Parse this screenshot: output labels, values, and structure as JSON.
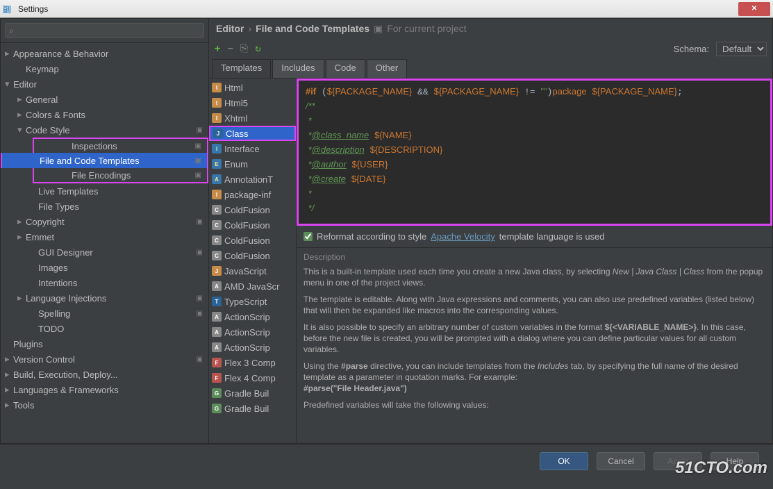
{
  "window_title": "Settings",
  "search_placeholder": "",
  "tree": [
    {
      "label": "Appearance & Behavior",
      "lvl": 0,
      "arrow": "closed"
    },
    {
      "label": "Keymap",
      "lvl": 1,
      "arrow": ""
    },
    {
      "label": "Editor",
      "lvl": 0,
      "arrow": "open"
    },
    {
      "label": "General",
      "lvl": 1,
      "arrow": "closed"
    },
    {
      "label": "Colors & Fonts",
      "lvl": 1,
      "arrow": "closed"
    },
    {
      "label": "Code Style",
      "lvl": 1,
      "arrow": "open",
      "proj": true
    },
    {
      "label": "Inspections",
      "lvl": 2,
      "arrow": "",
      "proj": true,
      "hl_top": true
    },
    {
      "label": "File and Code Templates",
      "lvl": 2,
      "arrow": "",
      "proj": true,
      "selected": true,
      "hl_mid": true
    },
    {
      "label": "File Encodings",
      "lvl": 2,
      "arrow": "",
      "proj": true,
      "hl_bot": true
    },
    {
      "label": "Live Templates",
      "lvl": 2,
      "arrow": ""
    },
    {
      "label": "File Types",
      "lvl": 2,
      "arrow": ""
    },
    {
      "label": "Copyright",
      "lvl": 1,
      "arrow": "closed",
      "proj": true
    },
    {
      "label": "Emmet",
      "lvl": 1,
      "arrow": "closed"
    },
    {
      "label": "GUI Designer",
      "lvl": 2,
      "arrow": "",
      "proj": true
    },
    {
      "label": "Images",
      "lvl": 2,
      "arrow": ""
    },
    {
      "label": "Intentions",
      "lvl": 2,
      "arrow": ""
    },
    {
      "label": "Language Injections",
      "lvl": 1,
      "arrow": "closed",
      "proj": true
    },
    {
      "label": "Spelling",
      "lvl": 2,
      "arrow": "",
      "proj": true
    },
    {
      "label": "TODO",
      "lvl": 2,
      "arrow": ""
    },
    {
      "label": "Plugins",
      "lvl": 0,
      "arrow": ""
    },
    {
      "label": "Version Control",
      "lvl": 0,
      "arrow": "closed",
      "proj": true
    },
    {
      "label": "Build, Execution, Deploy...",
      "lvl": 0,
      "arrow": "closed"
    },
    {
      "label": "Languages & Frameworks",
      "lvl": 0,
      "arrow": "closed"
    },
    {
      "label": "Tools",
      "lvl": 0,
      "arrow": "closed"
    }
  ],
  "breadcrumb": {
    "a": "Editor",
    "b": "File and Code Templates",
    "ctx": "For current project"
  },
  "schema_label": "Schema:",
  "schema_value": "Default",
  "tabs": [
    "Templates",
    "Includes",
    "Code",
    "Other"
  ],
  "active_tab": 0,
  "template_list": [
    {
      "label": "Html",
      "ic": "ij"
    },
    {
      "label": "Html5",
      "ic": "ij"
    },
    {
      "label": "Xhtml",
      "ic": "ij"
    },
    {
      "label": "Class",
      "ic": "java",
      "sel": true,
      "hl": true
    },
    {
      "label": "Interface",
      "ic": "iface"
    },
    {
      "label": "Enum",
      "ic": "enum"
    },
    {
      "label": "AnnotationT",
      "ic": "ann"
    },
    {
      "label": "package-inf",
      "ic": "ij"
    },
    {
      "label": "ColdFusion",
      "ic": "cf"
    },
    {
      "label": "ColdFusion",
      "ic": "cf"
    },
    {
      "label": "ColdFusion",
      "ic": "cf"
    },
    {
      "label": "ColdFusion",
      "ic": "cf"
    },
    {
      "label": "JavaScript",
      "ic": "js"
    },
    {
      "label": "AMD JavaScr",
      "ic": "amd"
    },
    {
      "label": "TypeScript",
      "ic": "ts"
    },
    {
      "label": "ActionScrip",
      "ic": "as"
    },
    {
      "label": "ActionScrip",
      "ic": "as"
    },
    {
      "label": "ActionScrip",
      "ic": "as"
    },
    {
      "label": "Flex 3 Comp",
      "ic": "flex"
    },
    {
      "label": "Flex 4 Comp",
      "ic": "flex"
    },
    {
      "label": "Gradle Buil",
      "ic": "gradle"
    },
    {
      "label": "Gradle Buil",
      "ic": "gradle"
    }
  ],
  "code_lines": [
    "#if (${PACKAGE_NAME} && ${PACKAGE_NAME} != \"\")package ${PACKAGE_NAME};",
    "/**",
    " *",
    " *@class_name ${NAME}",
    " *@description  ${DESCRIPTION}",
    " *@author ${USER}",
    " *@create  ${DATE}",
    " *",
    " */"
  ],
  "reformat": {
    "checked": true,
    "label": "Reformat according to style",
    "link": "Apache Velocity",
    "tail": "template language is used"
  },
  "desc_title": "Description",
  "desc_p1a": "This is a built-in template used each time you create a new Java class, by selecting ",
  "desc_p1i": "New | Java Class | Class",
  "desc_p1b": " from the popup menu in one of the project views.",
  "desc_p2": "The template is editable. Along with Java expressions and comments, you can also use predefined variables (listed below) that will then be expanded like macros into the corresponding values.",
  "desc_p3a": "It is also possible to specify an arbitrary number of custom variables in the format ",
  "desc_p3c": "${<VARIABLE_NAME>}",
  "desc_p3b": ". In this case, before the new file is created, you will be prompted with a dialog where you can define particular values for all custom variables.",
  "desc_p4a": "Using the ",
  "desc_p4c1": "#parse",
  "desc_p4b": " directive, you can include templates from the ",
  "desc_p4i": "Includes",
  "desc_p4d": " tab, by specifying the full name of the desired template as a parameter in quotation marks. For example:",
  "desc_p4c2": "#parse(\"File Header.java\")",
  "desc_p5": "Predefined variables will take the following values:",
  "buttons": {
    "ok": "OK",
    "cancel": "Cancel",
    "apply": "Apply",
    "help": "Help"
  },
  "watermark": "51CTO.com"
}
